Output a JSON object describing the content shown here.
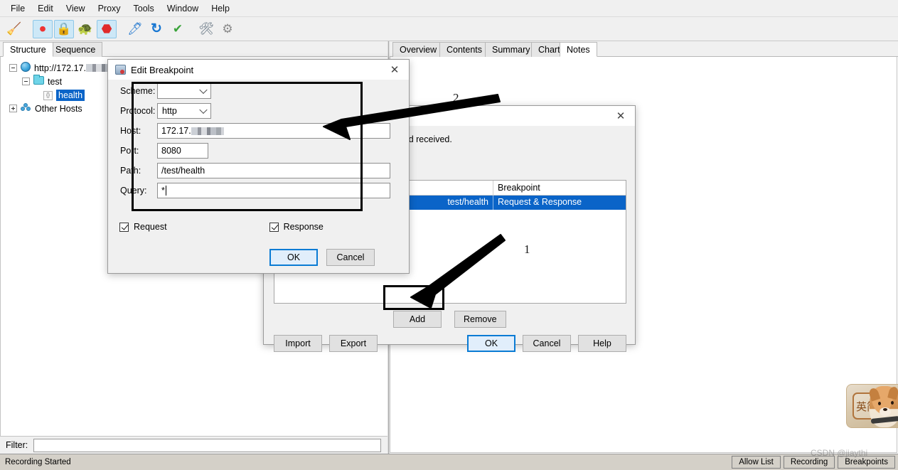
{
  "app": {
    "name": "Charles Proxy"
  },
  "menubar": {
    "items": [
      {
        "label": "File"
      },
      {
        "label": "Edit"
      },
      {
        "label": "View"
      },
      {
        "label": "Proxy"
      },
      {
        "label": "Tools"
      },
      {
        "label": "Window"
      },
      {
        "label": "Help"
      }
    ]
  },
  "toolbar": {
    "buttons": [
      {
        "name": "clear-session-icon",
        "glyph": "🧹",
        "active": false
      },
      {
        "name": "record-icon",
        "glyph": "⏺",
        "active": true
      },
      {
        "name": "ssl-proxying-icon",
        "glyph": "🔒",
        "active": true
      },
      {
        "name": "throttling-turtle-icon",
        "glyph": "🐢",
        "active": false
      },
      {
        "name": "breakpoints-stop-icon",
        "glyph": "⬣",
        "active": true
      },
      {
        "name": "compose-pen-icon",
        "glyph": "🖊",
        "active": false
      },
      {
        "name": "repeat-icon",
        "glyph": "↻",
        "active": false
      },
      {
        "name": "validate-check-icon",
        "glyph": "✔",
        "active": false
      },
      {
        "name": "tools-icon",
        "glyph": "🛠",
        "active": false
      },
      {
        "name": "settings-gear-icon",
        "glyph": "⚙",
        "active": false
      }
    ]
  },
  "left_panel": {
    "tabs": [
      {
        "label": "Structure",
        "selected": true
      },
      {
        "label": "Sequence",
        "selected": false
      }
    ],
    "tree": [
      {
        "label": "http://172.17.",
        "redacted": true,
        "icon": "globe-icon",
        "expander": "minus",
        "indent": 0,
        "selected": false
      },
      {
        "label": "test",
        "redacted": false,
        "icon": "folder-icon",
        "expander": "minus",
        "indent": 1,
        "selected": false
      },
      {
        "label": "health",
        "redacted": false,
        "icon": "document-icon",
        "expander": "none",
        "indent": 2,
        "selected": true
      },
      {
        "label": "Other Hosts",
        "redacted": false,
        "icon": "hosts-icon",
        "expander": "plus",
        "indent": 0,
        "selected": false
      }
    ],
    "filter": {
      "label": "Filter:",
      "value": "",
      "placeholder": ""
    }
  },
  "right_panel": {
    "tabs": [
      {
        "label": "Overview",
        "selected": false
      },
      {
        "label": "Contents",
        "selected": false
      },
      {
        "label": "Summary",
        "selected": false
      },
      {
        "label": "Chart",
        "selected": false
      },
      {
        "label": "Notes",
        "selected": true
      }
    ]
  },
  "breakpoint_settings_dialog": {
    "title": "",
    "close_label": "✕",
    "description": "responses before they are sent and received.",
    "table": {
      "headers": [
        "",
        "",
        "Breakpoint"
      ],
      "rows": [
        {
          "enabled": "",
          "location": "test/health",
          "breakpoint": "Request & Response",
          "selected": true
        }
      ]
    },
    "add_label": "Add",
    "remove_label": "Remove",
    "import_label": "Import",
    "export_label": "Export",
    "ok_label": "OK",
    "cancel_label": "Cancel",
    "help_label": "Help"
  },
  "edit_breakpoint_dialog": {
    "title": "Edit Breakpoint",
    "close_label": "✕",
    "fields": {
      "scheme": {
        "label": "Scheme:",
        "value": ""
      },
      "protocol": {
        "label": "Protocol:",
        "value": "http"
      },
      "host": {
        "label": "Host:",
        "value": "172.17."
      },
      "port": {
        "label": "Port:",
        "value": "8080"
      },
      "path": {
        "label": "Path:",
        "value": "/test/health"
      },
      "query": {
        "label": "Query:",
        "value": "*"
      }
    },
    "request_checkbox": {
      "label": "Request",
      "checked": true
    },
    "response_checkbox": {
      "label": "Response",
      "checked": true
    },
    "ok_label": "OK",
    "cancel_label": "Cancel"
  },
  "annotations": {
    "step_one": "1",
    "step_two": "2"
  },
  "statusbar": {
    "message": "Recording Started",
    "buttons": [
      {
        "label": "Allow List"
      },
      {
        "label": "Recording"
      },
      {
        "label": "Breakpoints"
      }
    ]
  },
  "pet_widget": {
    "plate_text": "英简"
  },
  "watermark": {
    "text": "CSDN @jiaythi"
  },
  "colors": {
    "selection_blue": "#0a64c8",
    "default_button_border": "#0a7bd4",
    "toolbar_active": "#cde8f7",
    "statusbar_bg": "#d4d0c8"
  }
}
